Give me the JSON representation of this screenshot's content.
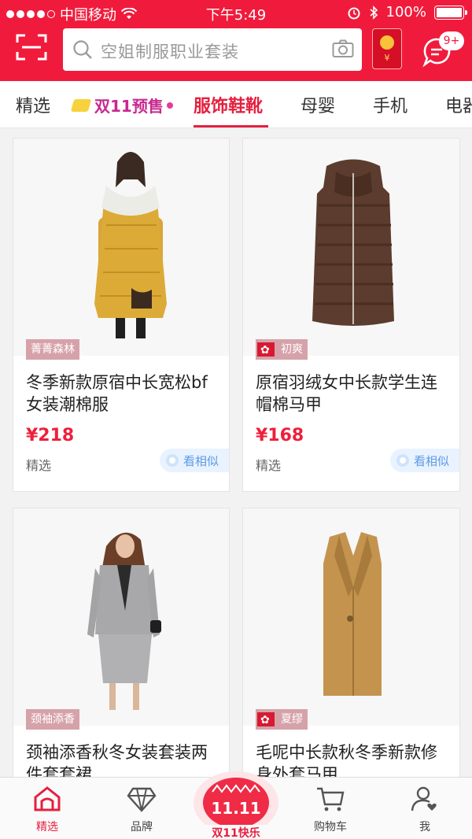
{
  "status_bar": {
    "carrier": "中国移动",
    "time": "下午5:49",
    "battery": "100%",
    "battery_level": 1.0
  },
  "search": {
    "placeholder": "空姐制服职业套装"
  },
  "header": {
    "message_badge": "9+",
    "redpack_symbol": "¥"
  },
  "tabs": [
    {
      "label": "精选"
    },
    {
      "label": "双11预售"
    },
    {
      "label": "服饰鞋靴",
      "active": true
    },
    {
      "label": "母婴"
    },
    {
      "label": "手机"
    },
    {
      "label": "电器"
    }
  ],
  "products": [
    {
      "shop": "菁菁森林",
      "title": "冬季新款原宿中长宽松bf女装潮棉服",
      "price": "¥218",
      "tag": "精选",
      "similar": "看相似",
      "flag": false
    },
    {
      "shop": "初爽",
      "title": "原宿羽绒女中长款学生连帽棉马甲",
      "price": "¥168",
      "tag": "精选",
      "similar": "看相似",
      "flag": true
    },
    {
      "shop": "颈袖添香",
      "title": "颈袖添香秋冬女装套装两件套套裙",
      "flag": false
    },
    {
      "shop": "夏缪",
      "title": "毛呢中长款秋冬季新款修身外套马甲",
      "flag": true
    }
  ],
  "bottom_nav": [
    {
      "label": "精选",
      "icon": "home-icon",
      "active": true
    },
    {
      "label": "品牌",
      "icon": "diamond-icon"
    },
    {
      "label": "双11快乐",
      "icon": "festival-1111-icon",
      "badge_text": "11.11"
    },
    {
      "label": "购物车",
      "icon": "cart-icon"
    },
    {
      "label": "我",
      "icon": "user-heart-icon"
    }
  ],
  "colors": {
    "brand_red": "#f01b3c",
    "price_red": "#ee1f3b",
    "similar_blue": "#5b9ae6"
  }
}
